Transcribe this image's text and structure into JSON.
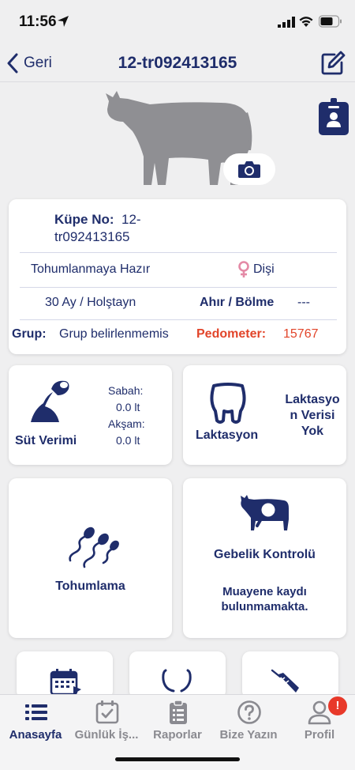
{
  "status_bar": {
    "time": "11:56"
  },
  "nav": {
    "back_label": "Geri",
    "title": "12-tr092413165"
  },
  "info": {
    "tag_label": "Küpe No:",
    "tag_value_line1": "12-",
    "tag_value_line2": "tr092413165",
    "status": "Tohumlanmaya Hazır",
    "sex": "Dişi",
    "age_breed": "30 Ay / Holştayn",
    "barn_label": "Ahır / Bölme",
    "barn_value": "---",
    "group_label": "Grup:",
    "group_value": "Grup belirlenmemis",
    "pedometer_label": "Pedometer:",
    "pedometer_value": "15767"
  },
  "milk": {
    "title": "Süt Verimi",
    "morning_label": "Sabah:",
    "morning_value": "0.0 lt",
    "evening_label": "Akşam:",
    "evening_value": "0.0 lt"
  },
  "lactation": {
    "title": "Laktasyon",
    "line1": "Laktasyo",
    "line2": "n Verisi",
    "line3": "Yok"
  },
  "insemination": {
    "title": "Tohumlama"
  },
  "pregnancy": {
    "title": "Gebelik Kontrolü",
    "line1": "Muayene kaydı",
    "line2": "bulunmamakta."
  },
  "tabs": [
    {
      "label": "Anasayfa",
      "icon": "list-icon",
      "active": true
    },
    {
      "label": "Günlük İş...",
      "icon": "calendar-check-icon"
    },
    {
      "label": "Raporlar",
      "icon": "clipboard-icon"
    },
    {
      "label": "Bize Yazın",
      "icon": "question-icon"
    },
    {
      "label": "Profil",
      "icon": "user-icon"
    }
  ],
  "profile_badge": "!",
  "colors": {
    "primary": "#1f2d6b",
    "accent_red": "#e2452a",
    "background": "#efeff0",
    "female_pink": "#e48aa6"
  }
}
